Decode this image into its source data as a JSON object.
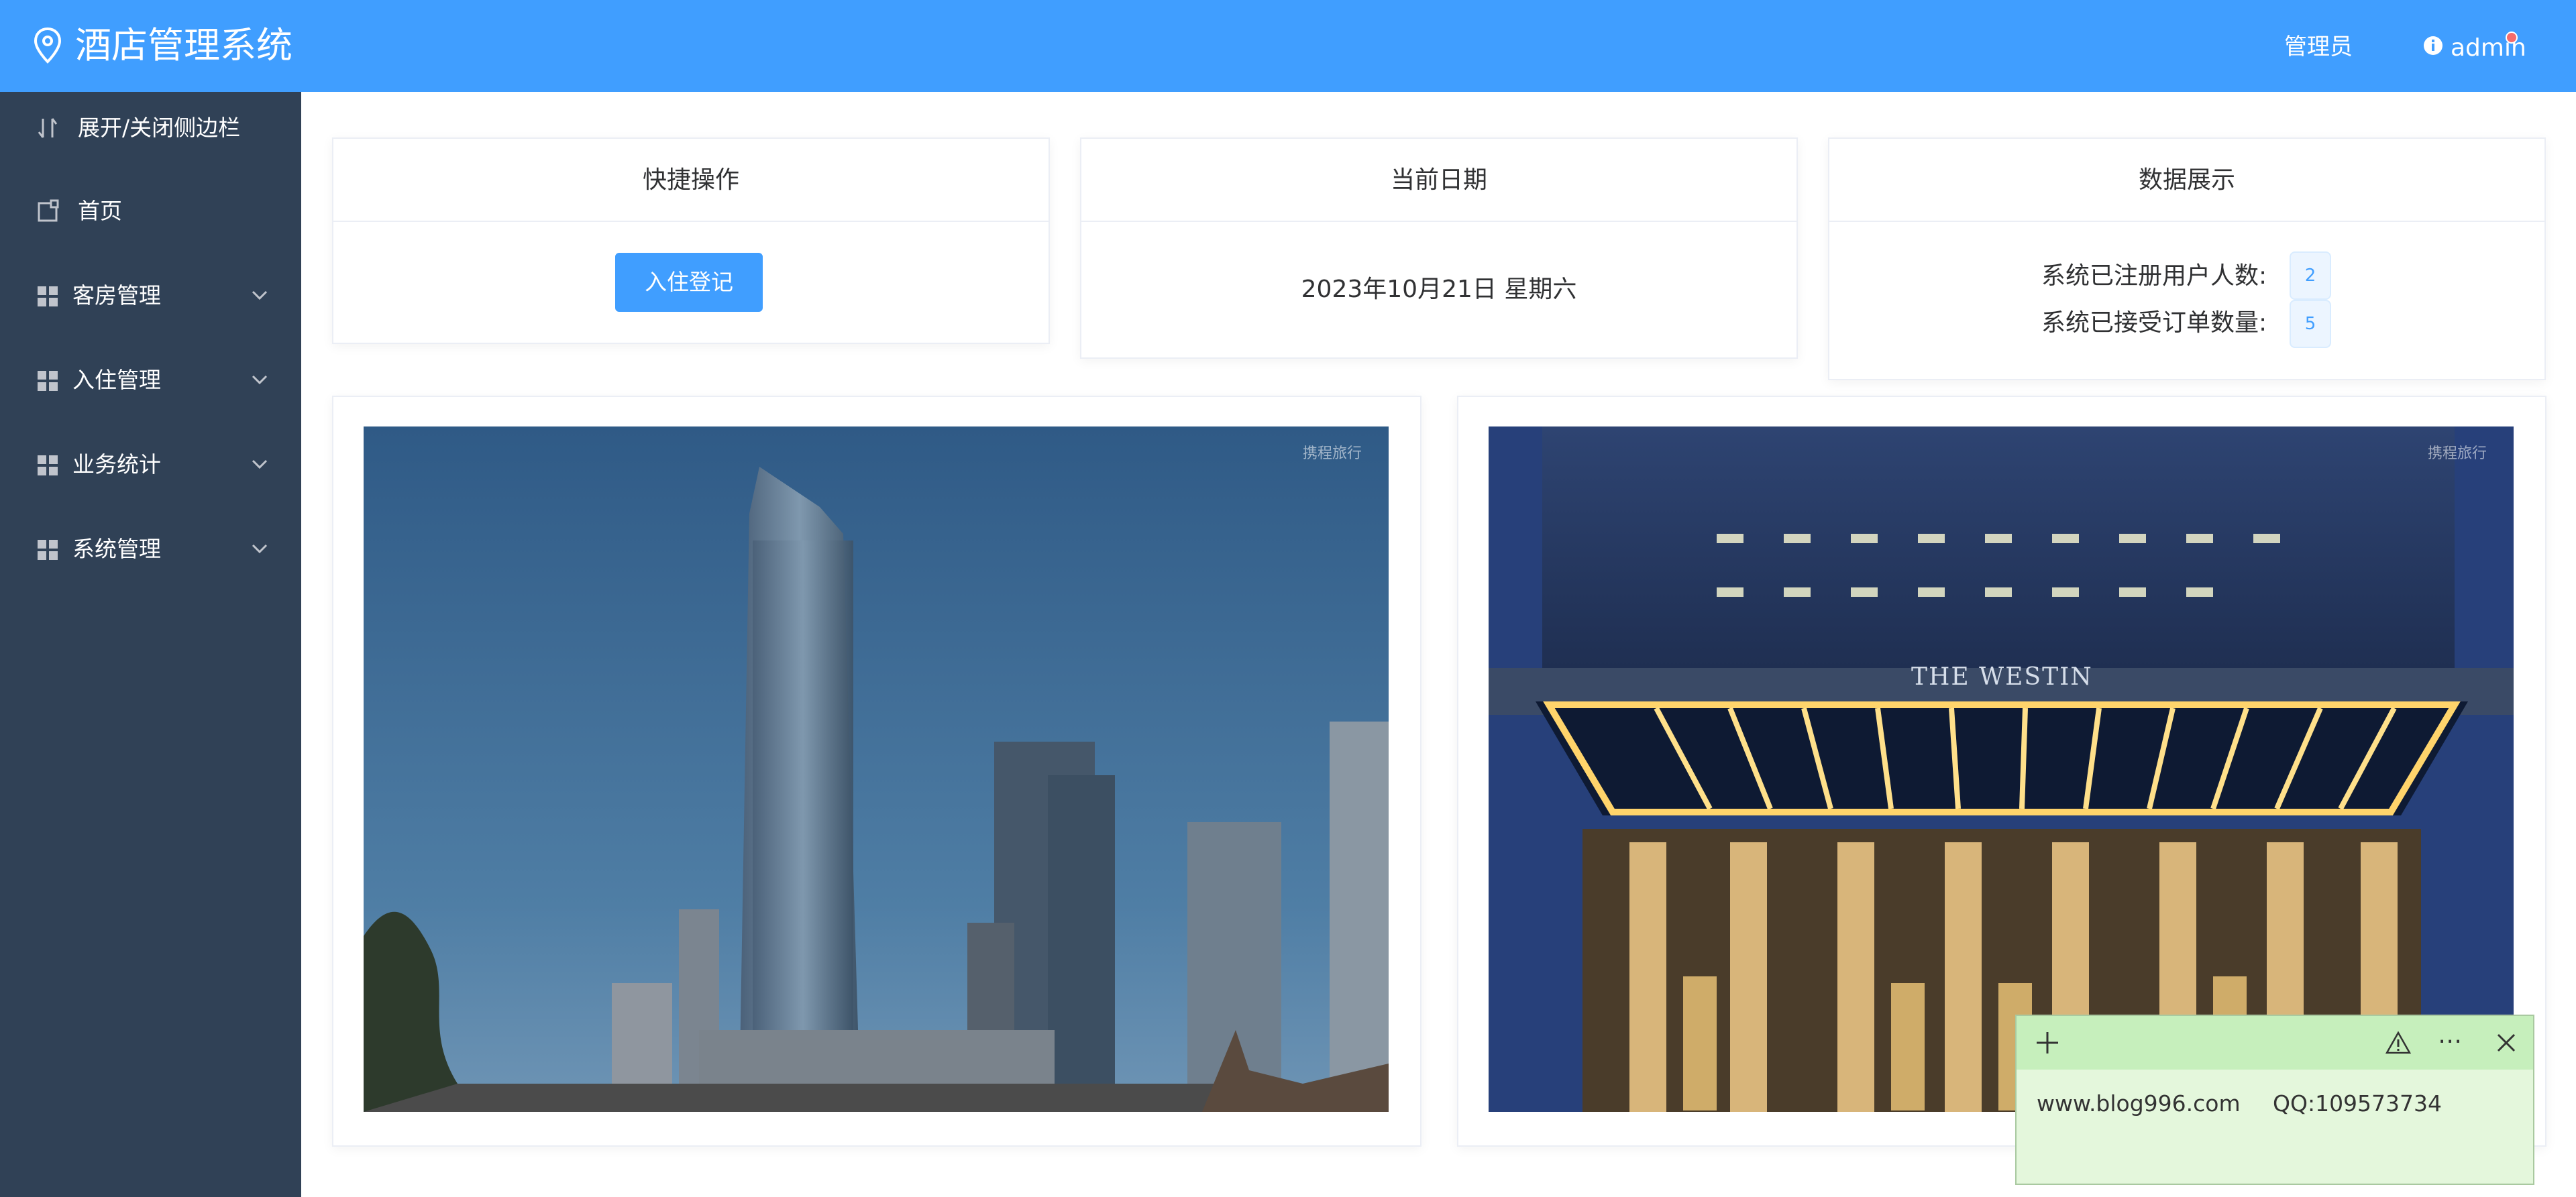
{
  "header": {
    "title": "酒店管理系统",
    "role": "管理员",
    "user": "admin",
    "notification": true,
    "icons": {
      "logo": "location-pin-icon",
      "info": "info-icon"
    }
  },
  "sidebar": {
    "items": [
      {
        "label": "展开/关闭侧边栏",
        "icon": "toggle-sort-icon"
      },
      {
        "label": "首页",
        "icon": "home-page-icon"
      },
      {
        "label": "客房管理",
        "icon": "grid-icon",
        "expandable": true
      },
      {
        "label": "入住管理",
        "icon": "grid-icon",
        "expandable": true
      },
      {
        "label": "业务统计",
        "icon": "grid-icon",
        "expandable": true
      },
      {
        "label": "系统管理",
        "icon": "grid-icon",
        "expandable": true
      }
    ]
  },
  "cards": {
    "quick_ops": {
      "title": "快捷操作",
      "button": "入住登记"
    },
    "date": {
      "title": "当前日期",
      "value": "2023年10月21日 星期六"
    },
    "stats": {
      "title": "数据展示",
      "rows": [
        {
          "label": "系统已注册用户人数:",
          "value": "2"
        },
        {
          "label": "系统已接受订单数量:",
          "value": "5"
        }
      ]
    }
  },
  "photos": [
    {
      "name": "hotel-tower-photo",
      "watermark": "携程旅行"
    },
    {
      "name": "hotel-entrance-photo",
      "watermark": "携程旅行",
      "sign": "THE WESTIN"
    }
  ],
  "sticky_note": {
    "site": "www.blog996.com",
    "qq": "QQ:109573734",
    "icons": [
      "plus-icon",
      "warning-icon",
      "more-icon",
      "close-icon"
    ]
  },
  "colors": {
    "header": "#409eff",
    "sidebar": "#304156",
    "accent": "#409eff",
    "note": "#e4f7dc"
  }
}
